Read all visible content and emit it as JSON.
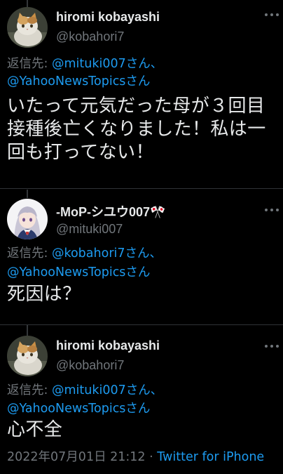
{
  "tweets": [
    {
      "display_name": "hiromi kobayashi",
      "handle": "@kobahori7",
      "reply_prefix": "返信先: ",
      "reply_mention_1": "@mituki007さん、",
      "reply_mention_2": "@YahooNewsTopicsさん",
      "text": "いたって元気だった母が３回目接種後亡くなりました！私は一回も打ってない！"
    },
    {
      "display_name": "-MoP-シユウ007🎌",
      "handle": "@mituki007",
      "reply_prefix": "返信先: ",
      "reply_mention_1": "@kobahori7さん、",
      "reply_mention_2": "@YahooNewsTopicsさん",
      "text": "死因は？"
    },
    {
      "display_name": "hiromi kobayashi",
      "handle": "@kobahori7",
      "reply_prefix": "返信先: ",
      "reply_mention_1": "@mituki007さん、",
      "reply_mention_2": "@YahooNewsTopicsさん",
      "text": "心不全"
    }
  ],
  "footer": {
    "timestamp": "2022年07月01日 21:12 · ",
    "source": "Twitter for iPhone"
  },
  "icons": {
    "more": "more-options-icon",
    "avatar_cat": "cat-photo-avatar",
    "avatar_anime": "anime-character-avatar"
  },
  "colors": {
    "background": "#000000",
    "primary_text": "#e7e9ea",
    "secondary_text": "#71767b",
    "link": "#1d9bf0"
  }
}
